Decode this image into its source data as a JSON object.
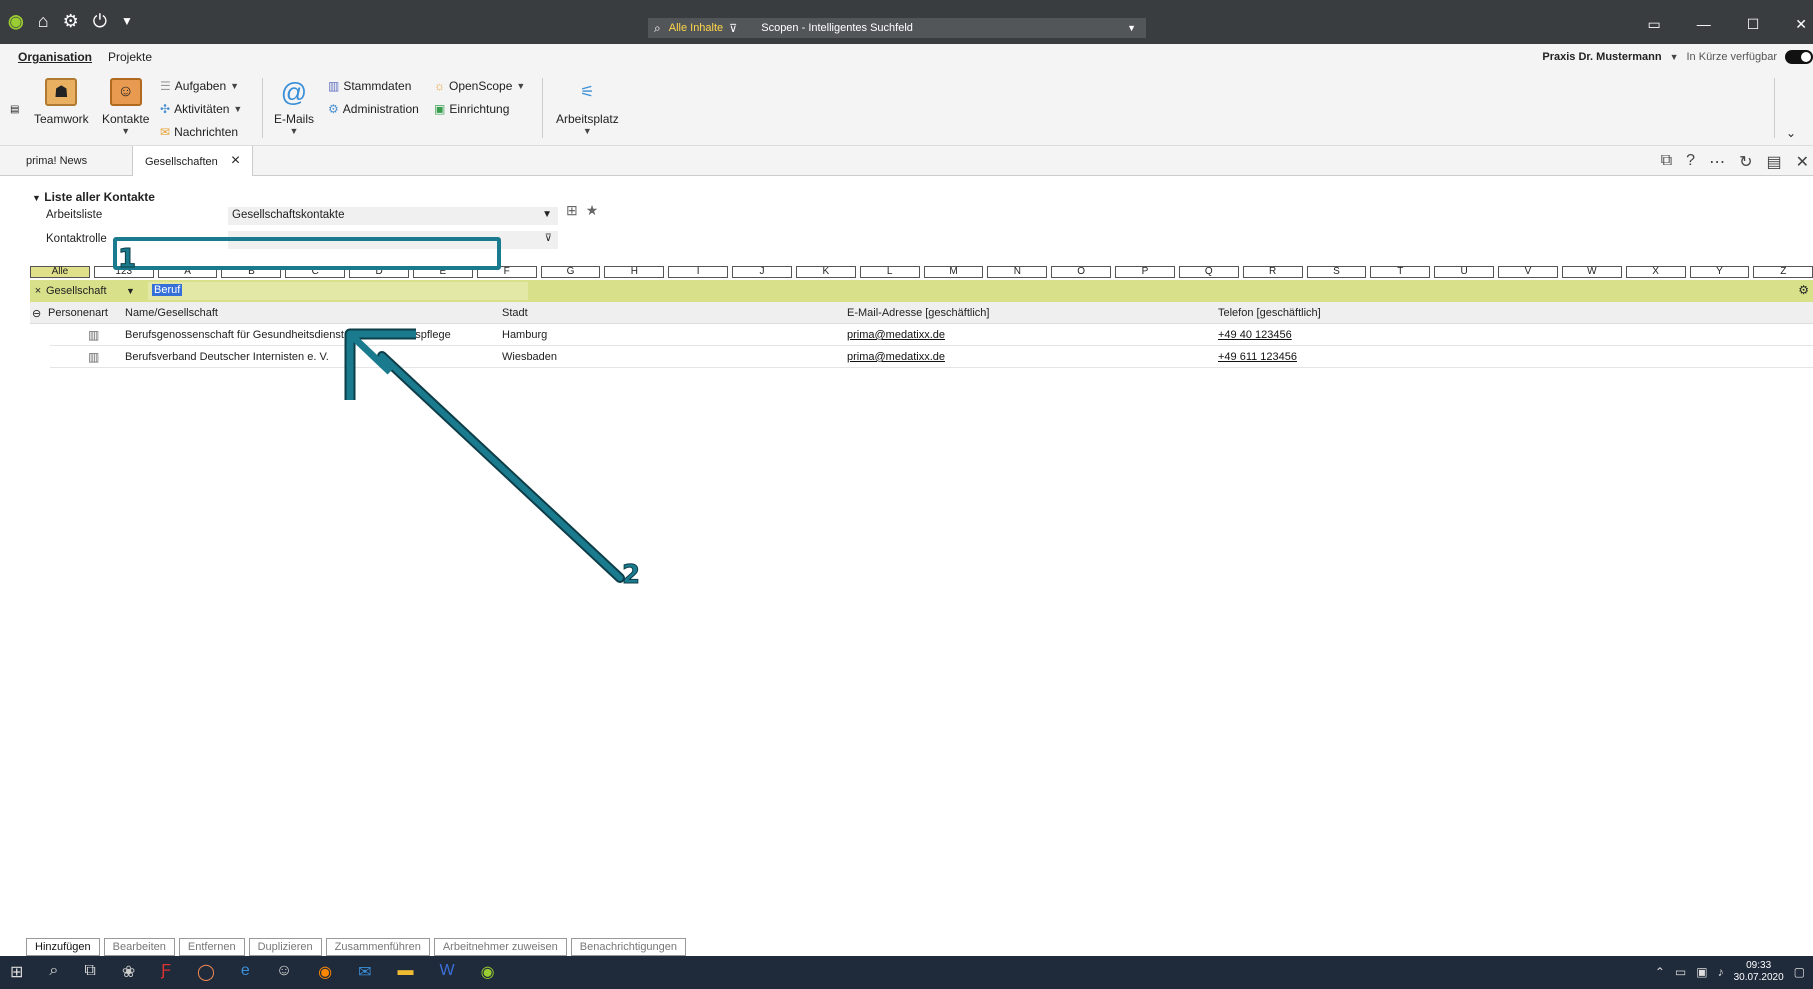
{
  "titlebar": {
    "search_scope": "Alle Inhalte",
    "search_placeholder": "Scopen - Intelligentes Suchfeld"
  },
  "ribbon_tabs": {
    "organisation": "Organisation",
    "projekte": "Projekte"
  },
  "user": {
    "name": "Praxis Dr. Mustermann",
    "status": "In Kürze verfügbar"
  },
  "ribbon": {
    "teamwork": "Teamwork",
    "kontakte": "Kontakte",
    "aufgaben": "Aufgaben",
    "aktivitaeten": "Aktivitäten",
    "nachrichten": "Nachrichten",
    "emails": "E-Mails",
    "stammdaten": "Stammdaten",
    "administration": "Administration",
    "openscope": "OpenScope",
    "einrichtung": "Einrichtung",
    "arbeitsplatz": "Arbeitsplatz"
  },
  "doctabs": {
    "news": "prima! News",
    "gesellschaften": "Gesellschaften"
  },
  "section": {
    "title": "Liste aller Kontakte",
    "arbeitsliste_label": "Arbeitsliste",
    "arbeitsliste_value": "Gesellschaftskontakte",
    "kontaktrolle_label": "Kontaktrolle"
  },
  "alpha": [
    "Alle",
    "123",
    "A",
    "B",
    "C",
    "D",
    "E",
    "F",
    "G",
    "H",
    "I",
    "J",
    "K",
    "L",
    "M",
    "N",
    "O",
    "P",
    "Q",
    "R",
    "S",
    "T",
    "U",
    "V",
    "W",
    "X",
    "Y",
    "Z"
  ],
  "filter": {
    "field": "Gesellschaft",
    "value": "Beruf"
  },
  "columns": {
    "personenart": "Personenart",
    "name": "Name/Gesellschaft",
    "stadt": "Stadt",
    "email": "E-Mail-Adresse [geschäftlich]",
    "telefon": "Telefon [geschäftlich]"
  },
  "rows": [
    {
      "name": "Berufsgenossenschaft für Gesundheitsdienst und Wohlfahrtspflege",
      "stadt": "Hamburg",
      "email": "prima@medatixx.de",
      "telefon": "+49 40 123456"
    },
    {
      "name": "Berufsverband Deutscher Internisten e. V.",
      "stadt": "Wiesbaden",
      "email": "prima@medatixx.de",
      "telefon": "+49 611 123456"
    }
  ],
  "annotations": {
    "one": "1",
    "two": "2"
  },
  "buttons": {
    "hinzufuegen": "Hinzufügen",
    "bearbeiten": "Bearbeiten",
    "entfernen": "Entfernen",
    "duplizieren": "Duplizieren",
    "zusammenfuehren": "Zusammenführen",
    "arbeitnehmer": "Arbeitnehmer zuweisen",
    "benachrichtigungen": "Benachrichtigungen"
  },
  "clock": {
    "time": "09:33",
    "date": "30.07.2020"
  },
  "icons": [
    "search-icon",
    "filter-icon",
    "gear-icon",
    "close-icon",
    "star-icon",
    "building-icon",
    "window-icon",
    "minimize-icon",
    "maximize-icon"
  ]
}
